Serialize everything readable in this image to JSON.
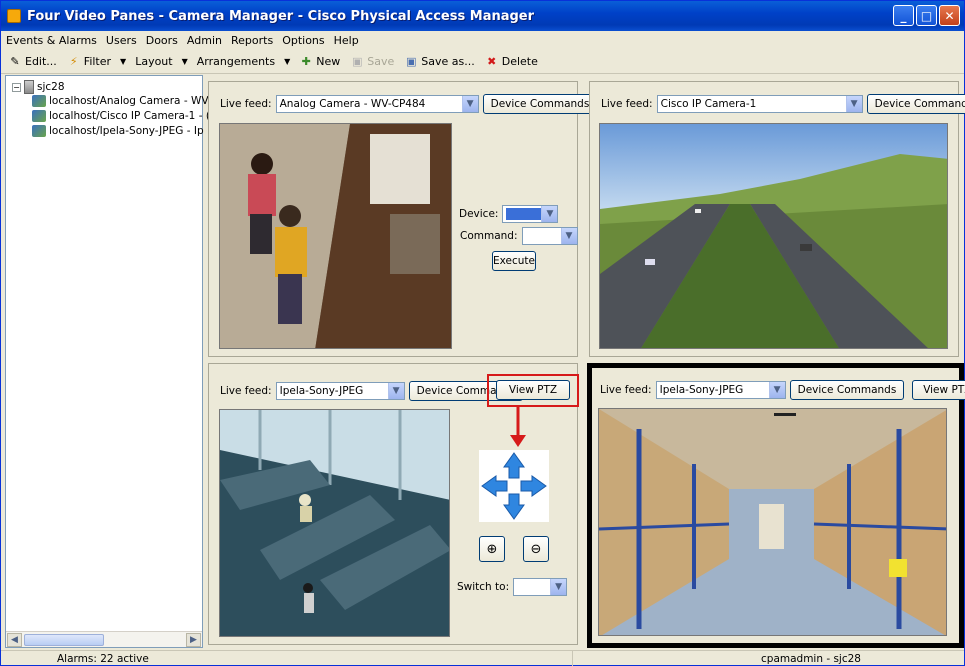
{
  "window": {
    "title": "Four Video Panes - Camera Manager - Cisco Physical Access Manager",
    "buttons": {
      "minimize": "_",
      "maximize": "□",
      "close": "✕"
    }
  },
  "menu": [
    "Events & Alarms",
    "Users",
    "Doors",
    "Admin",
    "Reports",
    "Options",
    "Help"
  ],
  "toolbar": {
    "edit": "Edit...",
    "filter": "Filter",
    "layout": "Layout",
    "arrangements": "Arrangements",
    "new": "New",
    "save": "Save",
    "save_as": "Save as...",
    "delete": "Delete"
  },
  "tree": {
    "root": "sjc28",
    "items": [
      "localhost/Analog Camera - WV",
      "localhost/Cisco IP Camera-1 - (",
      "localhost/Ipela-Sony-JPEG - Ip"
    ]
  },
  "panes": {
    "live_feed_label": "Live feed:",
    "device_commands": "Device Commands",
    "view_ptz": "View PTZ",
    "top_left": {
      "feed": "Analog Camera - WV-CP484",
      "device_label": "Device:",
      "command_label": "Command:",
      "execute": "Execute"
    },
    "top_right": {
      "feed": "Cisco IP Camera-1"
    },
    "bottom_left": {
      "feed": "Ipela-Sony-JPEG",
      "switch_to_label": "Switch to:"
    },
    "bottom_right": {
      "feed": "Ipela-Sony-JPEG"
    }
  },
  "status": {
    "alarms": "Alarms: 22 active",
    "user": "cpamadmin - sjc28"
  },
  "colors": {
    "titlebar": "#0041c8",
    "highlight": "#d61a1a",
    "ptz_arrow": "#2f86e0",
    "device_select": "#3a6fd8"
  }
}
